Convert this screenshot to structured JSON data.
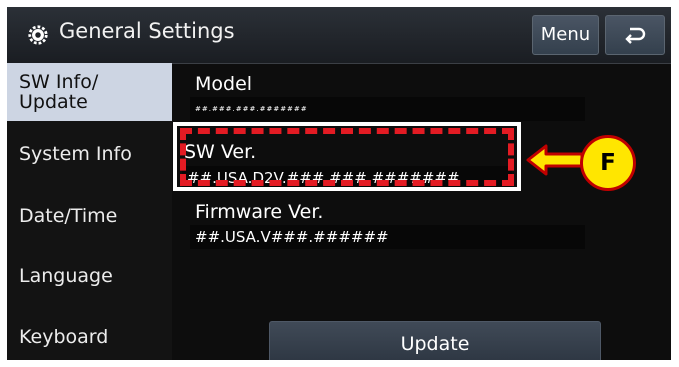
{
  "header": {
    "title": "General Settings",
    "menu_label": "Menu",
    "gear_icon": "gear-icon",
    "back_icon": "back-arrow-icon"
  },
  "sidebar": {
    "items": [
      {
        "label_line1": "SW Info/",
        "label_line2": "Update",
        "active": true
      },
      {
        "label": "System Info"
      },
      {
        "label": "Date/Time"
      },
      {
        "label": "Language"
      },
      {
        "label": "Keyboard"
      }
    ]
  },
  "main": {
    "model_label": "Model",
    "model_value": "##.###.###.#######",
    "sw_label": "SW Ver.",
    "sw_value": "##.USA.D2V.###.###.#######",
    "firmware_label": "Firmware Ver.",
    "firmware_value": "##.USA.V###.######",
    "update_label": "Update"
  },
  "annotation": {
    "callout_label": "F",
    "highlight_color": "#e31b23",
    "callout_color": "#ffe600"
  }
}
